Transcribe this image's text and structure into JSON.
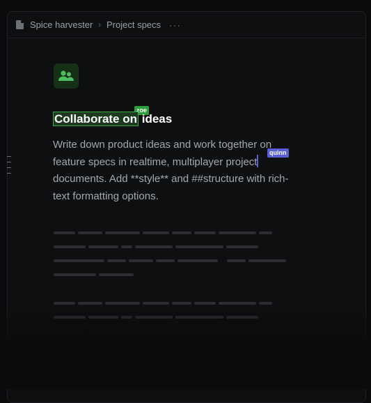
{
  "breadcrumb": {
    "workspace": "Spice harvester",
    "separator": "›",
    "page": "Project specs",
    "more": "···"
  },
  "document": {
    "heading_selected": "Collaborate on",
    "heading_rest": "ideas",
    "body_part1": "Write down product ideas and work together on feature specs in realtime, multiplayer project",
    "body_part2": "documents. Add **style** and ##structure with rich-text formatting options."
  },
  "collaborators": [
    {
      "name": "zoe",
      "color": "#2e9e3d"
    },
    {
      "name": "quinn",
      "color": "#5b5fd6"
    }
  ],
  "icons": {
    "doc": "document-icon",
    "app": "users-icon",
    "drag": "drag-handle-icon"
  }
}
